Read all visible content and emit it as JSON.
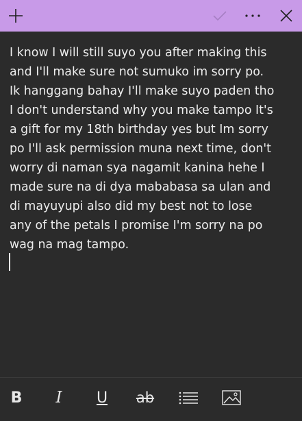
{
  "titlebar": {
    "add_icon": "plus-icon",
    "confirm_icon": "checkmark-icon",
    "menu_icon": "more-options-icon",
    "close_icon": "close-icon",
    "accent_color": "#c89ae8"
  },
  "note": {
    "text": "I know I will still suyo you after making this\nand I'll make sure not sumuko im sorry po.\nIk hanggang bahay I'll make suyo paden tho\nI don't understand why you make tampo It's\na gift for my 18th birthday yes but Im sorry\npo I'll ask permission muna next time, don't\nworry di naman sya nagamit kanina hehe I\nmade sure na di dya mababasa sa ulan and\ndi mayuyupi also did my best not to lose\nany of the petals I promise I'm sorry na po\nwag na mag tampo."
  },
  "toolbar": {
    "bold_label": "B",
    "italic_label": "I",
    "underline_label": "U",
    "strikethrough_label": "ab",
    "list_icon": "bulleted-list-icon",
    "image_icon": "insert-image-icon"
  }
}
